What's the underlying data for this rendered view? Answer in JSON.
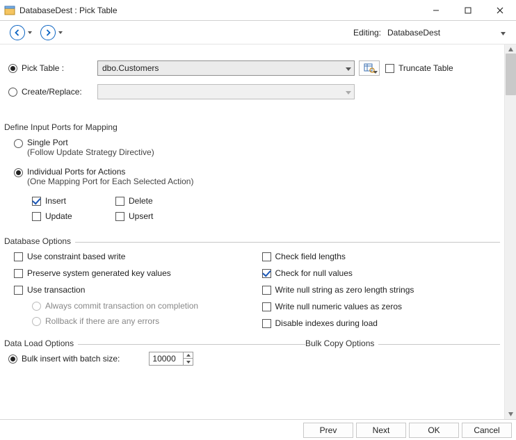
{
  "window": {
    "title": "DatabaseDest : Pick Table"
  },
  "toolbar": {
    "editing_label": "Editing:",
    "editing_value": "DatabaseDest"
  },
  "form": {
    "pick_table_label": "Pick Table :",
    "pick_table_value": "dbo.Customers",
    "create_replace_label": "Create/Replace:",
    "create_replace_value": "",
    "truncate_label": "Truncate Table"
  },
  "ports": {
    "header": "Define Input Ports for Mapping",
    "single_label": "Single Port",
    "single_sub": "(Follow Update Strategy Directive)",
    "individual_label": "Individual Ports for Actions",
    "individual_sub": "(One Mapping Port for Each Selected Action)",
    "actions": {
      "insert": "Insert",
      "update": "Update",
      "delete": "Delete",
      "upsert": "Upsert"
    }
  },
  "db_options": {
    "legend": "Database  Options",
    "left": {
      "constraint": "Use constraint based write",
      "preserve_keys": "Preserve system generated key values",
      "use_txn": "Use transaction",
      "txn_commit": "Always commit transaction on completion",
      "txn_rollback": "Rollback if there are any errors"
    },
    "right": {
      "check_lengths": "Check field lengths",
      "check_nulls": "Check for null values",
      "null_string": "Write null string as zero length strings",
      "null_numeric": "Write null numeric values as zeros",
      "disable_idx": "Disable indexes during load"
    }
  },
  "data_load": {
    "legend": "Data Load Options",
    "bulk_label": "Bulk insert with batch size:",
    "bulk_value": "10000",
    "bulk_copy_legend": "Bulk Copy Options"
  },
  "buttons": {
    "prev": "Prev",
    "next": "Next",
    "ok": "OK",
    "cancel": "Cancel"
  }
}
